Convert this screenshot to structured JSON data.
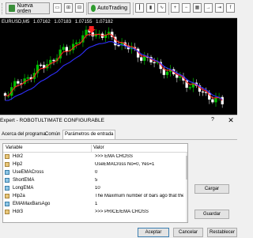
{
  "toolbar": {
    "new_order_label": "Nueva orden",
    "autotrading_label": "AutoTrading",
    "small_icons": [
      "D",
      "W",
      "MN"
    ]
  },
  "chart": {
    "symbol": "EURUSD,M5",
    "open": "1.07162",
    "high": "1.07183",
    "low": "1.07155",
    "close": "1.07182",
    "colors": {
      "background": "#000000",
      "bull": "#00c000",
      "bear": "#ffffff",
      "short_ema": "#ff2020",
      "long_ema": "#3030ff",
      "arrow": "#ff2020"
    }
  },
  "dialog": {
    "title": "Expert - ROBOTULTIMATE CONFIGURABLE",
    "help_label": "?",
    "close_label": "✕",
    "tabs": [
      "Acerca del programa",
      "Común",
      "Parámetros de entrada"
    ],
    "active_tab": "Parámetros de entrada",
    "columns": {
      "variable": "Variable",
      "value": "Valor"
    },
    "rows": [
      {
        "type": "string",
        "name": "Hdr2",
        "value": ">>> EMA CROSS"
      },
      {
        "type": "string",
        "name": "Hlp2",
        "value": "UseEMACross No=0, Yes=1"
      },
      {
        "type": "number",
        "name": "UseEMACross",
        "value": "0"
      },
      {
        "type": "number",
        "name": "ShortEMA",
        "value": "5"
      },
      {
        "type": "number",
        "name": "LongEMA",
        "value": "10"
      },
      {
        "type": "string",
        "name": "Hlp2a",
        "value": "The Maximum number of bars ago that the ..."
      },
      {
        "type": "number",
        "name": "EMAMaxBarsAgo",
        "value": "1"
      },
      {
        "type": "string",
        "name": "Hdr3",
        "value": ">>> PRICE/EMA CROSS"
      }
    ],
    "buttons": {
      "load": "Cargar",
      "save": "Guardar",
      "accept": "Aceptar",
      "cancel": "Cancelar",
      "reset": "Restablecer"
    }
  }
}
